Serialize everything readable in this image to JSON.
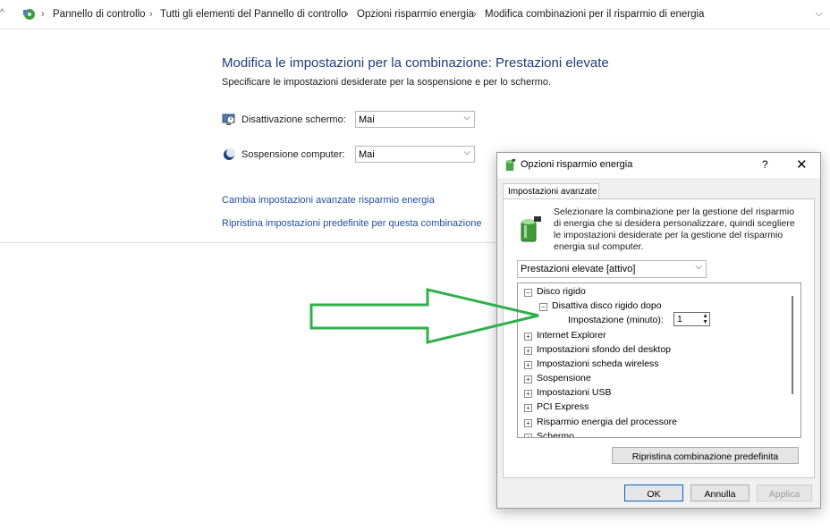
{
  "address_bar": {
    "breadcrumbs": [
      "Pannello di controllo",
      "Tutti gli elementi del Pannello di controllo",
      "Opzioni risparmio energia",
      "Modifica combinazioni per il risparmio di energia"
    ]
  },
  "main": {
    "title": "Modifica le impostazioni per la combinazione: Prestazioni elevate",
    "subtitle": "Specificare le impostazioni desiderate per la sospensione e per lo schermo.",
    "screen_off_label": "Disattivazione schermo:",
    "screen_off_value": "Mai",
    "sleep_label": "Sospensione computer:",
    "sleep_value": "Mai",
    "advanced_link": "Cambia impostazioni avanzate risparmio energia",
    "restore_link": "Ripristina impostazioni predefinite per questa combinazione"
  },
  "dialog": {
    "title": "Opzioni risparmio energia",
    "help": "?",
    "close": "✕",
    "tab": "Impostazioni avanzate",
    "description": "Selezionare la combinazione per la gestione del risparmio di energia che si desidera personalizzare, quindi scegliere le impostazioni desiderate per la gestione del risparmio energia sul computer.",
    "plan_select": "Prestazioni elevate [attivo]",
    "tree": {
      "disk": "Disco rigido",
      "disk_off": "Disattiva disco rigido dopo",
      "setting_label": "Impostazione (minuto):",
      "setting_value": "1",
      "items": [
        "Internet Explorer",
        "Impostazioni sfondo del desktop",
        "Impostazioni scheda wireless",
        "Sospensione",
        "Impostazioni USB",
        "PCI Express",
        "Risparmio energia del processore",
        "Schermo"
      ]
    },
    "restore_button": "Ripristina combinazione predefinita",
    "ok": "OK",
    "cancel": "Annulla",
    "apply": "Applica"
  },
  "colors": {
    "link": "#1f4e9c",
    "title": "#1e3d7a",
    "arrow": "#2fb04a"
  }
}
